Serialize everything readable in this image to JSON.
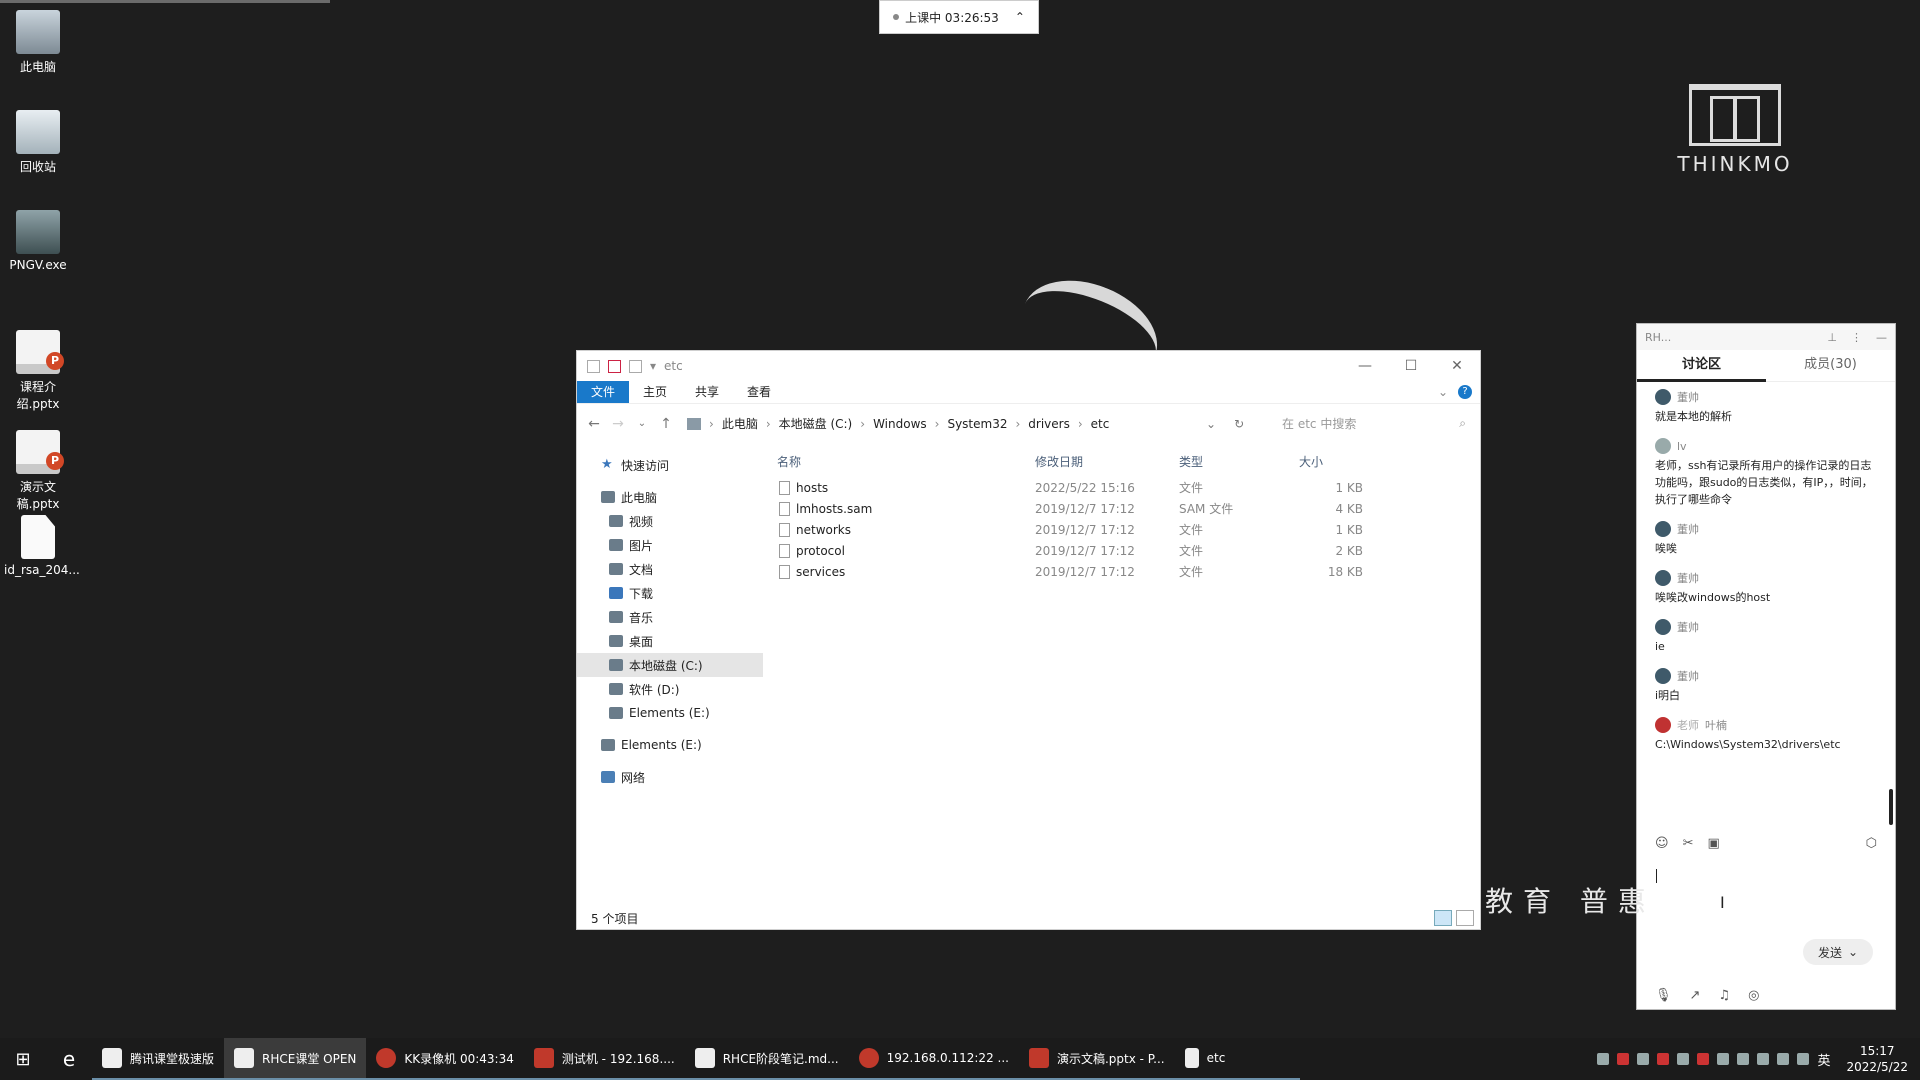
{
  "desktop": {
    "icons": [
      {
        "label": "此电脑",
        "icon": "computer-icon"
      },
      {
        "label": "回收站",
        "icon": "recycle-bin-icon"
      },
      {
        "label": "PNGV.exe",
        "icon": "png-viewer-icon"
      },
      {
        "label": "课程介绍.pptx",
        "icon": "powerpoint-file-icon"
      },
      {
        "label": "演示文稿.pptx",
        "icon": "powerpoint-file-icon"
      },
      {
        "label": "id_rsa_204...",
        "icon": "blank-file-icon"
      }
    ],
    "logo_text": "THINKMO",
    "calligraphy": "教育 普惠"
  },
  "timer": {
    "label": "上课中 03:26:53"
  },
  "explorer": {
    "title": "etc",
    "ribbon_tabs": [
      "文件",
      "主页",
      "共享",
      "查看"
    ],
    "breadcrumbs": [
      "此电脑",
      "本地磁盘 (C:)",
      "Windows",
      "System32",
      "drivers",
      "etc"
    ],
    "search_placeholder": "在 etc 中搜索",
    "nav": {
      "quick_access": "快速访问",
      "this_pc": "此电脑",
      "children": [
        "视频",
        "图片",
        "文档",
        "下载",
        "音乐",
        "桌面",
        "本地磁盘 (C:)",
        "软件 (D:)",
        "Elements (E:)"
      ],
      "elements_drive": "Elements (E:)",
      "network": "网络"
    },
    "columns": {
      "name": "名称",
      "date": "修改日期",
      "type": "类型",
      "size": "大小"
    },
    "files": [
      {
        "name": "hosts",
        "date": "2022/5/22 15:16",
        "type": "文件",
        "size": "1 KB"
      },
      {
        "name": "lmhosts.sam",
        "date": "2019/12/7 17:12",
        "type": "SAM 文件",
        "size": "4 KB"
      },
      {
        "name": "networks",
        "date": "2019/12/7 17:12",
        "type": "文件",
        "size": "1 KB"
      },
      {
        "name": "protocol",
        "date": "2019/12/7 17:12",
        "type": "文件",
        "size": "2 KB"
      },
      {
        "name": "services",
        "date": "2019/12/7 17:12",
        "type": "文件",
        "size": "18 KB"
      }
    ],
    "status": "5 个项目"
  },
  "chat": {
    "window_title": "RH...",
    "tabs": {
      "discussion": "讨论区",
      "members": "成员(30)"
    },
    "messages": [
      {
        "user": "董帅",
        "role": "",
        "text": "就是本地的解析"
      },
      {
        "user": "lv",
        "role": "",
        "text": "老师，ssh有记录所有用户的操作记录的日志功能吗，跟sudo的日志类似，有IP，，时间，执行了哪些命令"
      },
      {
        "user": "董帅",
        "role": "",
        "text": "唉唉"
      },
      {
        "user": "董帅",
        "role": "",
        "text": "唉唉改windows的host"
      },
      {
        "user": "董帅",
        "role": "",
        "text": "ie"
      },
      {
        "user": "董帅",
        "role": "",
        "text": "i明白"
      },
      {
        "user": "叶楠",
        "role": "老师",
        "text": "C:\\Windows\\System32\\drivers\\etc"
      }
    ],
    "send_label": "发送"
  },
  "taskbar": {
    "items": [
      {
        "label": "腾讯课堂极速版",
        "active": false
      },
      {
        "label": "RHCE课堂 OPEN",
        "active": true
      },
      {
        "label": "KK录像机 00:43:34",
        "active": false
      },
      {
        "label": "测试机 - 192.168....",
        "active": false
      },
      {
        "label": "RHCE阶段笔记.md...",
        "active": false
      },
      {
        "label": "192.168.0.112:22 ...",
        "active": false
      },
      {
        "label": "演示文稿.pptx - P...",
        "active": false
      },
      {
        "label": "etc",
        "active": false
      }
    ],
    "lang": "英",
    "time": "15:17",
    "date": "2022/5/22"
  }
}
